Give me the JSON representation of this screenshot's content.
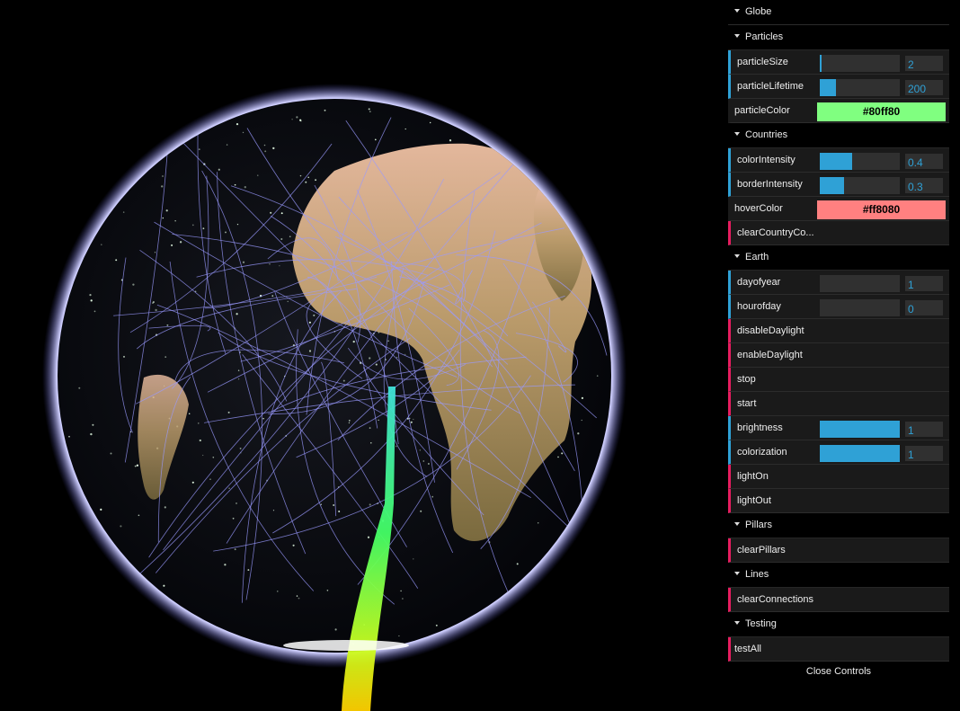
{
  "gui": {
    "root_title": "Globe",
    "folders": {
      "particles": {
        "title": "Particles",
        "particleSize": {
          "label": "particleSize",
          "value": "2",
          "fill": 0.02
        },
        "particleLifetime": {
          "label": "particleLifetime",
          "value": "200",
          "fill": 0.2
        },
        "particleColor": {
          "label": "particleColor",
          "value": "#80ff80",
          "color": "#80ff80"
        }
      },
      "countries": {
        "title": "Countries",
        "colorIntensity": {
          "label": "colorIntensity",
          "value": "0.4",
          "fill": 0.4
        },
        "borderIntensity": {
          "label": "borderIntensity",
          "value": "0.3",
          "fill": 0.3
        },
        "hoverColor": {
          "label": "hoverColor",
          "value": "#ff8080",
          "color": "#ff8080"
        },
        "clear": {
          "label": "clearCountryCo..."
        }
      },
      "earth": {
        "title": "Earth",
        "dayofyear": {
          "label": "dayofyear",
          "value": "1",
          "fill": 0
        },
        "hourofday": {
          "label": "hourofday",
          "value": "0",
          "fill": 0
        },
        "disableDaylight": {
          "label": "disableDaylight"
        },
        "enableDaylight": {
          "label": "enableDaylight"
        },
        "stop": {
          "label": "stop"
        },
        "start": {
          "label": "start"
        },
        "brightness": {
          "label": "brightness",
          "value": "1",
          "fill": 1
        },
        "colorization": {
          "label": "colorization",
          "value": "1",
          "fill": 1
        },
        "lightOn": {
          "label": "lightOn"
        },
        "lightOut": {
          "label": "lightOut"
        }
      },
      "pillars": {
        "title": "Pillars",
        "clear": {
          "label": "clearPillars"
        }
      },
      "lines": {
        "title": "Lines",
        "clear": {
          "label": "clearConnections"
        }
      },
      "testing": {
        "title": "Testing",
        "testAll": {
          "label": "testAll"
        }
      }
    },
    "close_label": "Close Controls"
  },
  "colors": {
    "number_accent": "#2fa1d6",
    "function_accent": "#e61d5f",
    "atmosphere": "#8a8aff",
    "connection_line": "#9a9aff"
  }
}
